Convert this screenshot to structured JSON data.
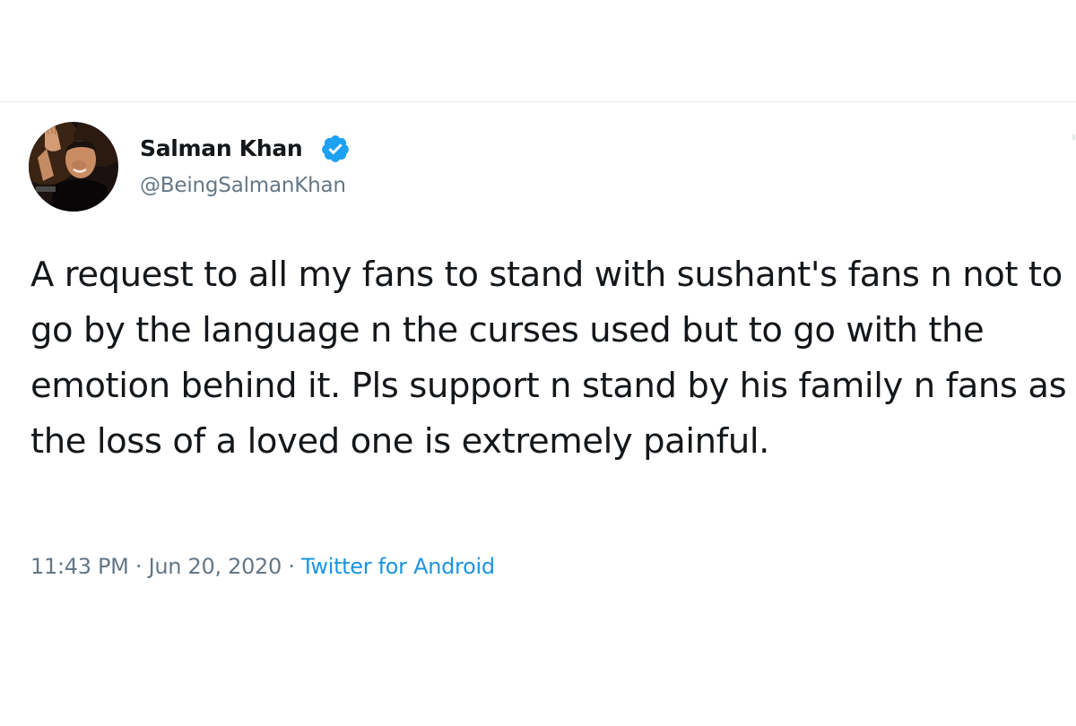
{
  "tweet": {
    "author": {
      "name": "Salman Khan",
      "handle": "@BeingSalmanKhan",
      "verified": true
    },
    "text": "A request to all my fans to stand with sushant's fans n not to go by the language n the curses used but to go with the emotion behind it. Pls support n stand by his family n fans as the loss of a loved one is extremely painful.",
    "time": "11:43 PM",
    "separator_1": " · ",
    "date": "Jun 20, 2020",
    "separator_2": " · ",
    "source": "Twitter for Android"
  },
  "colors": {
    "text_primary": "#14171a",
    "text_secondary": "#657786",
    "link": "#1b95e0",
    "verified_badge": "#1da1f2",
    "divider": "#e6ecf0"
  },
  "icons": {
    "verified": "verified-badge-icon",
    "avatar": "profile-photo"
  }
}
